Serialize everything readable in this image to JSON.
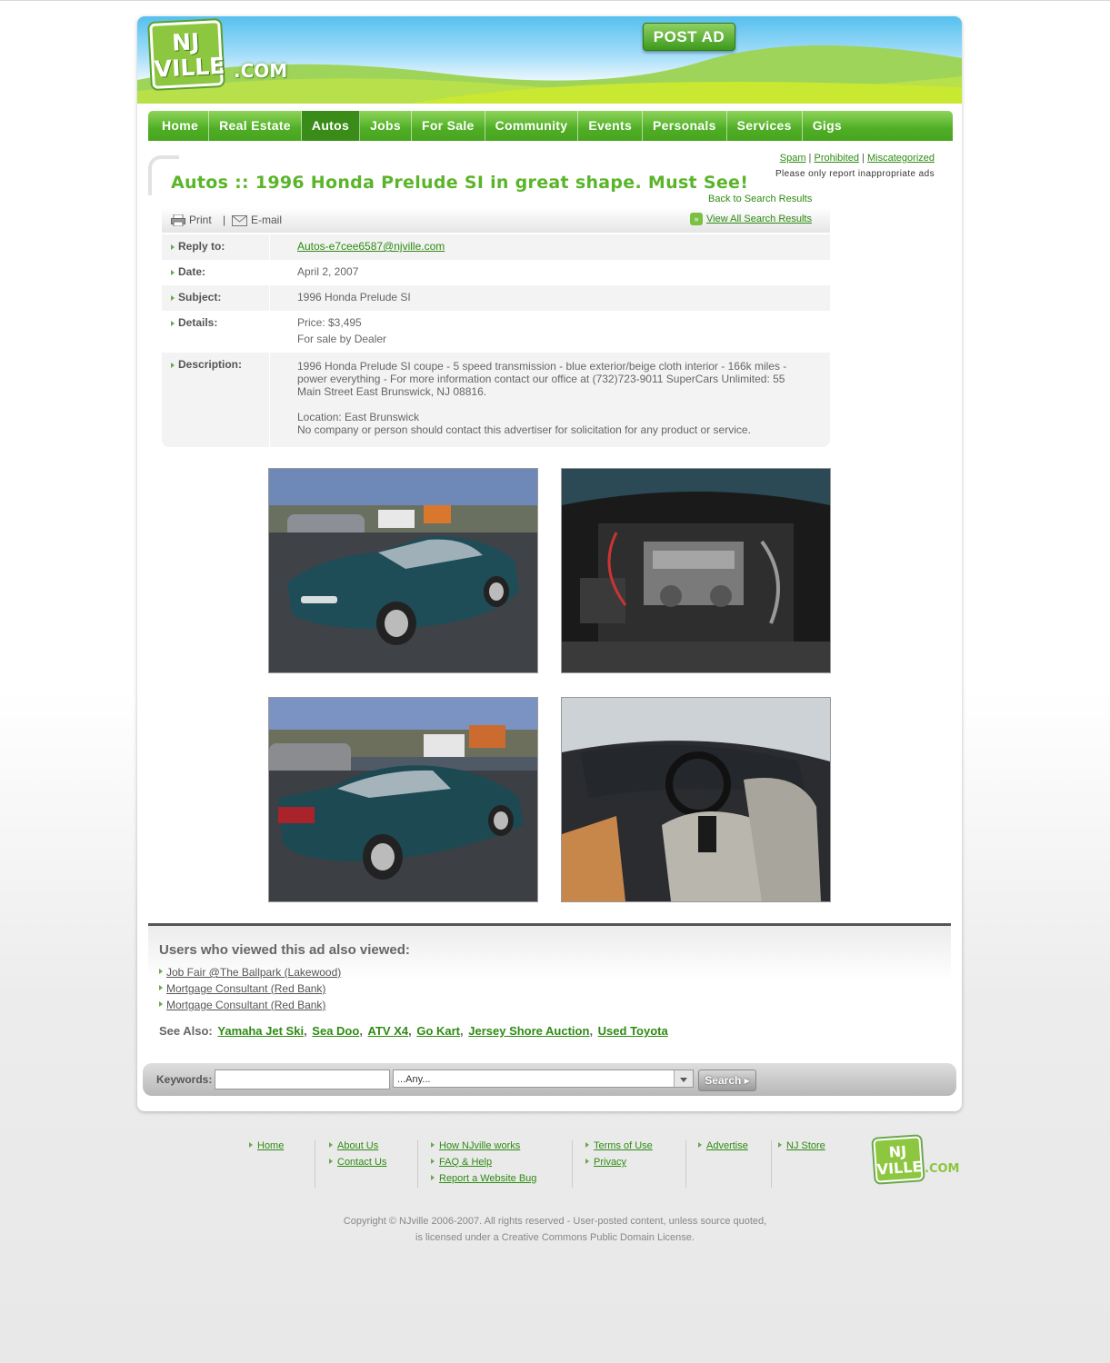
{
  "header": {
    "logo_text": "NJ VILLE",
    "logo_com": ".COM",
    "post_ad": "POST AD"
  },
  "nav": [
    "Home",
    "Real Estate",
    "Autos",
    "Jobs",
    "For Sale",
    "Community",
    "Events",
    "Personals",
    "Services",
    "Gigs"
  ],
  "nav_active": "Autos",
  "report": {
    "spam": "Spam",
    "prohibited": "Prohibited",
    "miscategorized": "Miscategorized",
    "note": "Please only report inappropriate ads"
  },
  "ad": {
    "title": "Autos :: 1996 Honda Prelude SI in great shape. Must See!",
    "back_to_results": "Back to Search Results",
    "print": "Print",
    "email": "E-mail",
    "view_all": "View All Search Results",
    "fields": {
      "reply_label": "Reply to:",
      "reply_value": "Autos-e7cee6587@njville.com",
      "date_label": "Date:",
      "date_value": "April 2, 2007",
      "subject_label": "Subject:",
      "subject_value": "1996 Honda Prelude SI",
      "details_label": "Details:",
      "price": "Price: $3,495",
      "seller": "For sale by Dealer",
      "description_label": "Description:",
      "description": "1996 Honda Prelude SI coupe - 5 speed transmission - blue exterior/beige cloth interior - 166k miles - power everything - For more information contact our office at (732)723-9011 SuperCars Unlimited: 55 Main Street East Brunswick, NJ 08816.",
      "location": "Location: East Brunswick",
      "disclaimer": "No company or person should contact this advertiser for solicitation for any product or service."
    }
  },
  "also_viewed": {
    "title": "Users who viewed this ad also viewed:",
    "items": [
      "Job Fair @The Ballpark (Lakewood)",
      "Mortgage Consultant (Red Bank)",
      "Mortgage Consultant (Red Bank)"
    ]
  },
  "see_also": {
    "label": "See Also:",
    "links": [
      "Yamaha Jet Ski",
      "Sea Doo",
      "ATV X4",
      "Go Kart",
      "Jersey Shore Auction",
      "Used Toyota"
    ]
  },
  "search": {
    "keywords_label": "Keywords:",
    "select_value": "...Any...",
    "button": "Search"
  },
  "footer": {
    "col1": [
      "Home"
    ],
    "col2": [
      "About Us",
      "Contact Us"
    ],
    "col3": [
      "How NJville works",
      "FAQ & Help",
      "Report a Website Bug"
    ],
    "col4": [
      "Terms of Use",
      "Privacy"
    ],
    "col5": [
      "Advertise"
    ],
    "col6": [
      "NJ Store"
    ],
    "logo_text": "NJ VILLE",
    "logo_com": ".COM",
    "copyright_1": "Copyright © NJville 2006-2007. All rights reserved - User-posted content, unless source quoted,",
    "copyright_2": "is licensed under a Creative Commons Public Domain License."
  },
  "colors": {
    "brand_green": "#5ab52a",
    "link_green": "#2e8b12",
    "nav_green": "#4fae25"
  }
}
